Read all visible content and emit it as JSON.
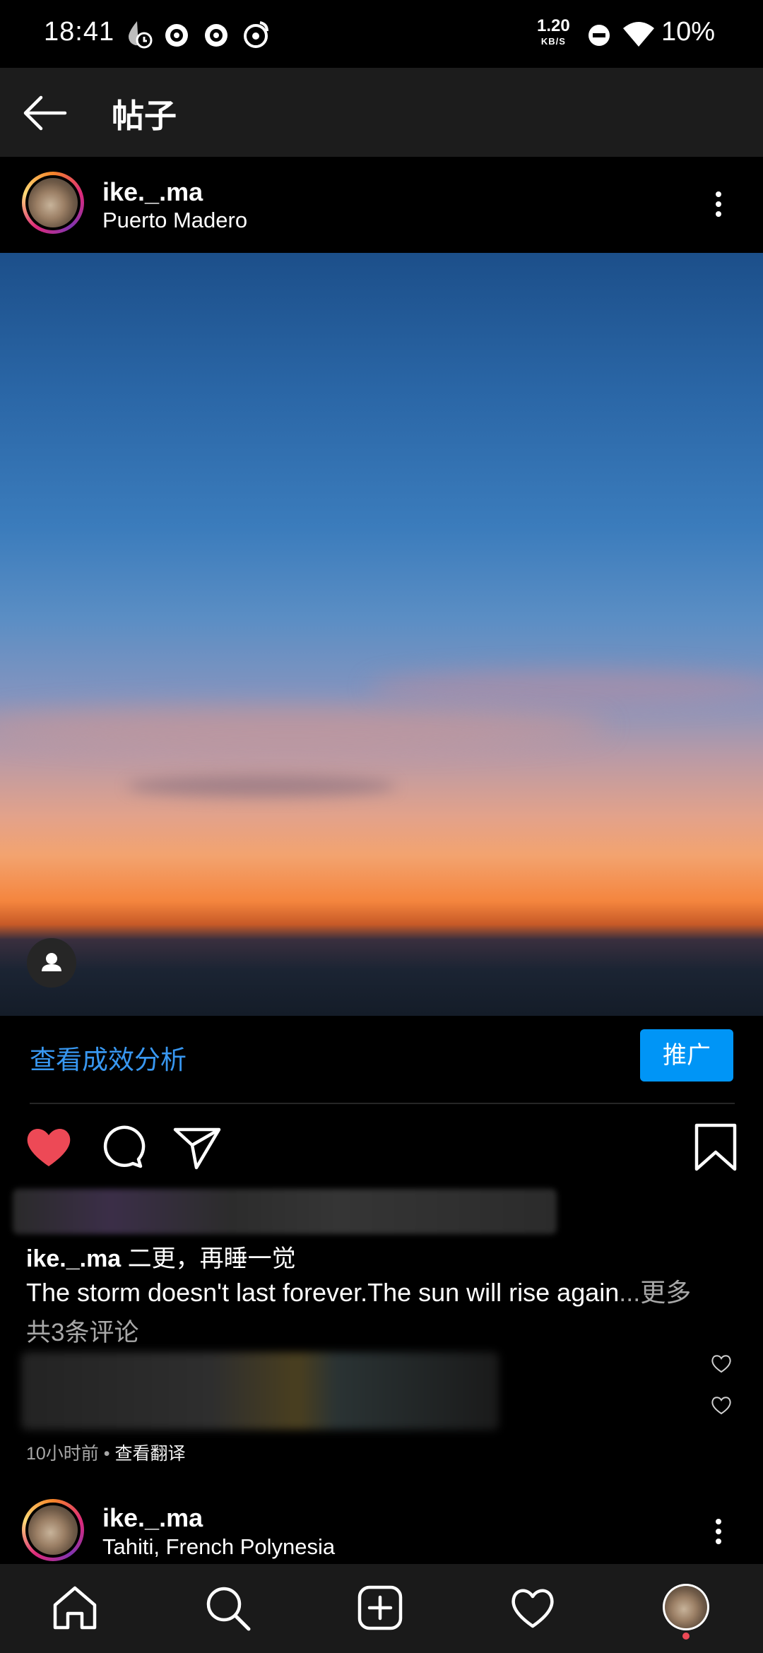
{
  "status_bar": {
    "time": "18:41",
    "net_speed_value": "1.20",
    "net_speed_unit": "KB/S",
    "battery": "10%",
    "icons": [
      "drop-clock-icon",
      "notification-app-icon",
      "notification-app-icon",
      "weibo-icon",
      "do-not-disturb-icon",
      "wifi-icon"
    ]
  },
  "header": {
    "back_icon": "arrow-left-icon",
    "title": "帖子"
  },
  "post": {
    "username": "ike._.ma",
    "location": "Puerto Madero",
    "insights_link": "查看成效分析",
    "promote_button": "推广",
    "caption_username": "ike._.ma",
    "caption_title": "二更，再睡一觉",
    "caption_text": "The storm doesn't last forever.The sun will rise again",
    "caption_ellipsis": "...",
    "more_label": "更多",
    "comments_link": "共3条评论",
    "time_ago": "10小时前",
    "separator": " • ",
    "translate_link": "查看翻译",
    "liked": true
  },
  "next_post": {
    "username": "ike._.ma",
    "location": "Tahiti, French Polynesia"
  },
  "bottom_nav": {
    "items": [
      "home-icon",
      "search-icon",
      "new-post-icon",
      "activity-heart-icon",
      "profile-avatar"
    ]
  },
  "colors": {
    "like_red": "#ed4956",
    "link_blue": "#3897f0",
    "promote_blue": "#0095f6"
  }
}
